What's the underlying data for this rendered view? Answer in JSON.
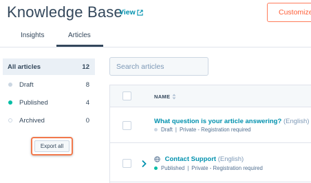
{
  "header": {
    "title": "Knowledge Base",
    "view_label": "View",
    "customize_label": "Customize"
  },
  "tabs": [
    {
      "label": "Insights",
      "active": false
    },
    {
      "label": "Articles",
      "active": true
    }
  ],
  "sidebar": {
    "items": [
      {
        "label": "All articles",
        "count": "12",
        "status": "all"
      },
      {
        "label": "Draft",
        "count": "8",
        "status": "draft"
      },
      {
        "label": "Published",
        "count": "4",
        "status": "published"
      },
      {
        "label": "Archived",
        "count": "0",
        "status": "archived"
      }
    ],
    "export_label": "Export all"
  },
  "search": {
    "placeholder": "Search articles"
  },
  "table": {
    "column_name": "NAME",
    "rows": [
      {
        "title": "What question is your article answering?",
        "language": "(English)",
        "status": "Draft",
        "visibility": "Private - Registration required"
      },
      {
        "title": "Contact Support",
        "language": "(English)",
        "status": "Published",
        "visibility": "Private - Registration required"
      }
    ]
  },
  "colors": {
    "accent": "#ff7a59",
    "link": "#0091ae",
    "text": "#33475b",
    "published": "#00bda5",
    "draft": "#cbd6e2"
  }
}
